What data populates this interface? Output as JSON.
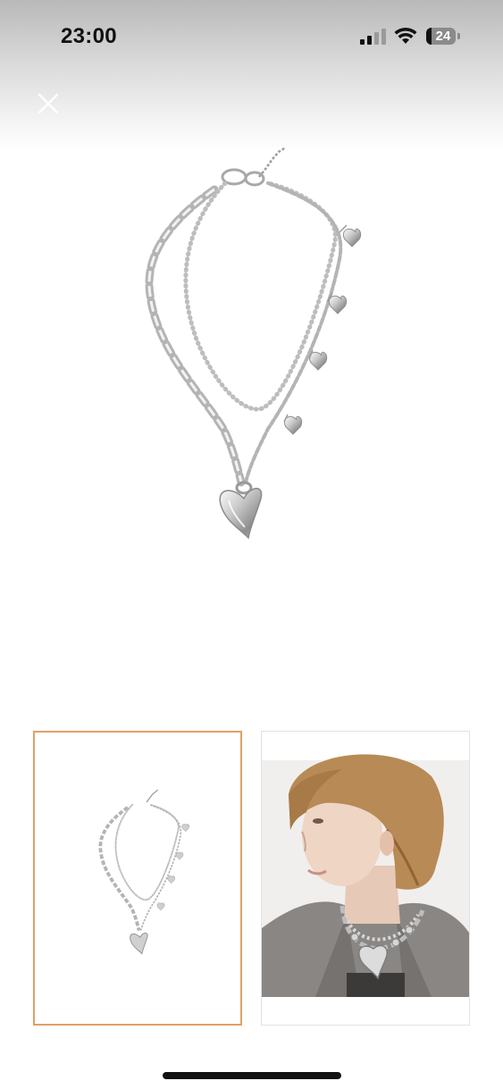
{
  "status_bar": {
    "time": "23:00",
    "battery_level": "24",
    "icons": [
      "cellular-signal-icon",
      "wifi-icon",
      "battery-icon"
    ]
  },
  "viewer": {
    "close_icon": "close-icon",
    "main_image": "silver-heart-layered-necklace",
    "thumbnails": [
      {
        "image": "necklace-product-shot",
        "selected": true
      },
      {
        "image": "model-wearing-necklace",
        "selected": false
      }
    ]
  },
  "colors": {
    "selected_thumb_border": "#e0a067",
    "thumb_border": "#e2e2e2",
    "header_gradient_top": "#b9b9b9"
  }
}
